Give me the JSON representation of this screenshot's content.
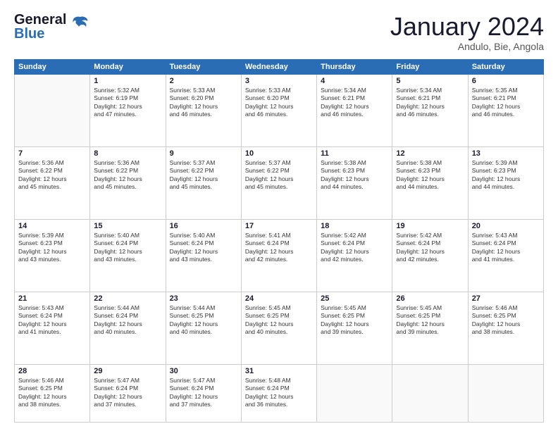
{
  "logo": {
    "line1": "General",
    "line2": "Blue"
  },
  "header": {
    "month": "January 2024",
    "location": "Andulo, Bie, Angola"
  },
  "weekdays": [
    "Sunday",
    "Monday",
    "Tuesday",
    "Wednesday",
    "Thursday",
    "Friday",
    "Saturday"
  ],
  "weeks": [
    [
      {
        "num": "",
        "info": ""
      },
      {
        "num": "1",
        "info": "Sunrise: 5:32 AM\nSunset: 6:19 PM\nDaylight: 12 hours\nand 47 minutes."
      },
      {
        "num": "2",
        "info": "Sunrise: 5:33 AM\nSunset: 6:20 PM\nDaylight: 12 hours\nand 46 minutes."
      },
      {
        "num": "3",
        "info": "Sunrise: 5:33 AM\nSunset: 6:20 PM\nDaylight: 12 hours\nand 46 minutes."
      },
      {
        "num": "4",
        "info": "Sunrise: 5:34 AM\nSunset: 6:21 PM\nDaylight: 12 hours\nand 46 minutes."
      },
      {
        "num": "5",
        "info": "Sunrise: 5:34 AM\nSunset: 6:21 PM\nDaylight: 12 hours\nand 46 minutes."
      },
      {
        "num": "6",
        "info": "Sunrise: 5:35 AM\nSunset: 6:21 PM\nDaylight: 12 hours\nand 46 minutes."
      }
    ],
    [
      {
        "num": "7",
        "info": "Sunrise: 5:36 AM\nSunset: 6:22 PM\nDaylight: 12 hours\nand 45 minutes."
      },
      {
        "num": "8",
        "info": "Sunrise: 5:36 AM\nSunset: 6:22 PM\nDaylight: 12 hours\nand 45 minutes."
      },
      {
        "num": "9",
        "info": "Sunrise: 5:37 AM\nSunset: 6:22 PM\nDaylight: 12 hours\nand 45 minutes."
      },
      {
        "num": "10",
        "info": "Sunrise: 5:37 AM\nSunset: 6:22 PM\nDaylight: 12 hours\nand 45 minutes."
      },
      {
        "num": "11",
        "info": "Sunrise: 5:38 AM\nSunset: 6:23 PM\nDaylight: 12 hours\nand 44 minutes."
      },
      {
        "num": "12",
        "info": "Sunrise: 5:38 AM\nSunset: 6:23 PM\nDaylight: 12 hours\nand 44 minutes."
      },
      {
        "num": "13",
        "info": "Sunrise: 5:39 AM\nSunset: 6:23 PM\nDaylight: 12 hours\nand 44 minutes."
      }
    ],
    [
      {
        "num": "14",
        "info": "Sunrise: 5:39 AM\nSunset: 6:23 PM\nDaylight: 12 hours\nand 43 minutes."
      },
      {
        "num": "15",
        "info": "Sunrise: 5:40 AM\nSunset: 6:24 PM\nDaylight: 12 hours\nand 43 minutes."
      },
      {
        "num": "16",
        "info": "Sunrise: 5:40 AM\nSunset: 6:24 PM\nDaylight: 12 hours\nand 43 minutes."
      },
      {
        "num": "17",
        "info": "Sunrise: 5:41 AM\nSunset: 6:24 PM\nDaylight: 12 hours\nand 42 minutes."
      },
      {
        "num": "18",
        "info": "Sunrise: 5:42 AM\nSunset: 6:24 PM\nDaylight: 12 hours\nand 42 minutes."
      },
      {
        "num": "19",
        "info": "Sunrise: 5:42 AM\nSunset: 6:24 PM\nDaylight: 12 hours\nand 42 minutes."
      },
      {
        "num": "20",
        "info": "Sunrise: 5:43 AM\nSunset: 6:24 PM\nDaylight: 12 hours\nand 41 minutes."
      }
    ],
    [
      {
        "num": "21",
        "info": "Sunrise: 5:43 AM\nSunset: 6:24 PM\nDaylight: 12 hours\nand 41 minutes."
      },
      {
        "num": "22",
        "info": "Sunrise: 5:44 AM\nSunset: 6:24 PM\nDaylight: 12 hours\nand 40 minutes."
      },
      {
        "num": "23",
        "info": "Sunrise: 5:44 AM\nSunset: 6:25 PM\nDaylight: 12 hours\nand 40 minutes."
      },
      {
        "num": "24",
        "info": "Sunrise: 5:45 AM\nSunset: 6:25 PM\nDaylight: 12 hours\nand 40 minutes."
      },
      {
        "num": "25",
        "info": "Sunrise: 5:45 AM\nSunset: 6:25 PM\nDaylight: 12 hours\nand 39 minutes."
      },
      {
        "num": "26",
        "info": "Sunrise: 5:45 AM\nSunset: 6:25 PM\nDaylight: 12 hours\nand 39 minutes."
      },
      {
        "num": "27",
        "info": "Sunrise: 5:46 AM\nSunset: 6:25 PM\nDaylight: 12 hours\nand 38 minutes."
      }
    ],
    [
      {
        "num": "28",
        "info": "Sunrise: 5:46 AM\nSunset: 6:25 PM\nDaylight: 12 hours\nand 38 minutes."
      },
      {
        "num": "29",
        "info": "Sunrise: 5:47 AM\nSunset: 6:24 PM\nDaylight: 12 hours\nand 37 minutes."
      },
      {
        "num": "30",
        "info": "Sunrise: 5:47 AM\nSunset: 6:24 PM\nDaylight: 12 hours\nand 37 minutes."
      },
      {
        "num": "31",
        "info": "Sunrise: 5:48 AM\nSunset: 6:24 PM\nDaylight: 12 hours\nand 36 minutes."
      },
      {
        "num": "",
        "info": ""
      },
      {
        "num": "",
        "info": ""
      },
      {
        "num": "",
        "info": ""
      }
    ]
  ]
}
